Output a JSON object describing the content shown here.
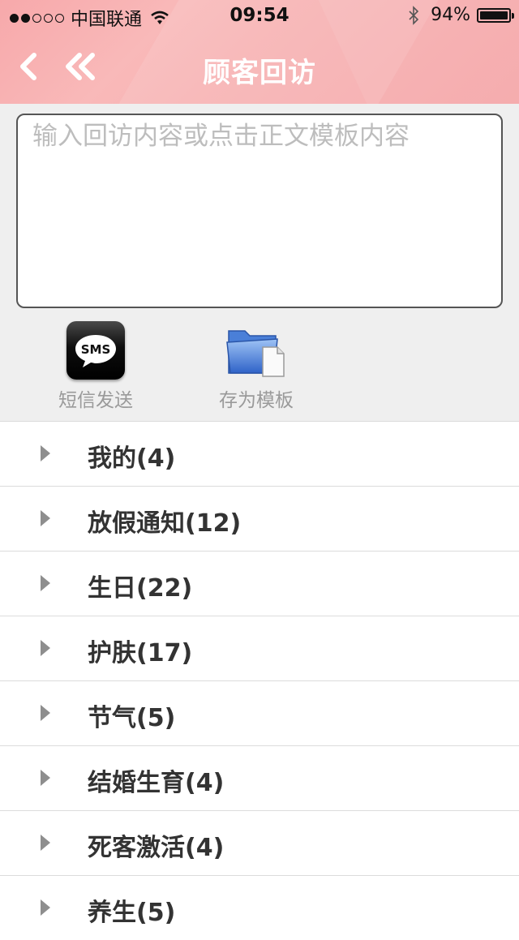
{
  "status_bar": {
    "carrier": "中国联通",
    "time": "09:54",
    "battery": "94%",
    "battery_level": 0.94,
    "signal_strength": 2
  },
  "nav": {
    "title": "顾客回访",
    "back_icon": "chevron-left-icon",
    "home_icon": "double-chevron-left-icon"
  },
  "composer": {
    "placeholder": "输入回访内容或点击正文模板内容",
    "value": ""
  },
  "actions": {
    "sms_label": "短信发送",
    "sms_icon_text": "SMS",
    "save_template_label": "存为模板"
  },
  "categories": [
    {
      "label": "我的(4)"
    },
    {
      "label": "放假通知(12)"
    },
    {
      "label": "生日(22)"
    },
    {
      "label": "护肤(17)"
    },
    {
      "label": "节气(5)"
    },
    {
      "label": "结婚生育(4)"
    },
    {
      "label": "死客激活(4)"
    },
    {
      "label": "养生(5)"
    }
  ],
  "colors": {
    "header": "#f7a9ab",
    "title": "#ffffff",
    "composer_bg": "#efefef"
  }
}
